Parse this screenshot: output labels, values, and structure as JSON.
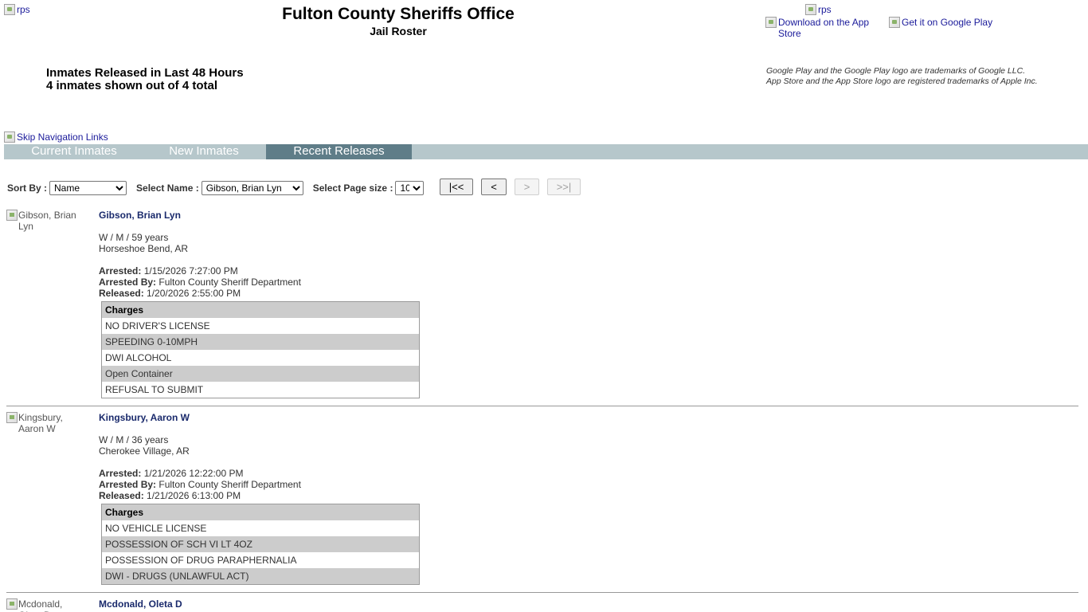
{
  "header": {
    "logo_left_alt": "rps",
    "logo_right_alt": "rps",
    "title": "Fulton County Sheriffs Office",
    "subtitle": "Jail Roster",
    "app_store_alt": "Download on the App Store",
    "google_play_alt": "Get it on Google Play",
    "trademark_line1": "Google Play and the Google Play logo are trademarks of Google LLC.",
    "trademark_line2": "App Store and the App Store logo are registered trademarks of Apple Inc."
  },
  "summary": {
    "heading": "Inmates Released in Last 48 Hours",
    "count": "4 inmates shown out of 4 total"
  },
  "nav": {
    "skip_alt": "Skip Navigation Links",
    "tabs": [
      {
        "label": "Current Inmates"
      },
      {
        "label": "New Inmates"
      },
      {
        "label": "Recent Releases"
      }
    ]
  },
  "controls": {
    "sort_label": "Sort By :",
    "sort_value": "Name",
    "name_label": "Select Name :",
    "name_value": "Gibson, Brian Lyn",
    "page_size_label": "Select Page size :",
    "page_size_value": "10",
    "first_label": "|<<",
    "prev_label": "<",
    "next_label": ">",
    "last_label": ">>|"
  },
  "labels": {
    "arrested": "Arrested:",
    "arrested_by": "Arrested By:",
    "released": "Released:",
    "charges": "Charges"
  },
  "inmates": [
    {
      "photo_alt": "Gibson, Brian Lyn",
      "name": "Gibson, Brian Lyn",
      "demographics": "W / M / 59 years",
      "city": "Horseshoe Bend, AR",
      "arrested": "1/15/2026 7:27:00 PM",
      "arrested_by": "Fulton County Sheriff Department",
      "released": "1/20/2026 2:55:00 PM",
      "charges": [
        "NO DRIVER'S LICENSE",
        "SPEEDING 0-10MPH",
        "DWI ALCOHOL",
        "Open Container",
        "REFUSAL TO SUBMIT"
      ]
    },
    {
      "photo_alt": "Kingsbury, Aaron W",
      "name": "Kingsbury, Aaron W",
      "demographics": "W / M / 36 years",
      "city": "Cherokee Village, AR",
      "arrested": "1/21/2026 12:22:00 PM",
      "arrested_by": "Fulton County Sheriff Department",
      "released": "1/21/2026 6:13:00 PM",
      "charges": [
        "NO VEHICLE LICENSE",
        "POSSESSION OF SCH VI LT 4OZ",
        "POSSESSION OF DRUG PARAPHERNALIA",
        "DWI - DRUGS (UNLAWFUL ACT)"
      ]
    },
    {
      "photo_alt": "Mcdonald, Oleta D",
      "name": "Mcdonald, Oleta D"
    }
  ]
}
